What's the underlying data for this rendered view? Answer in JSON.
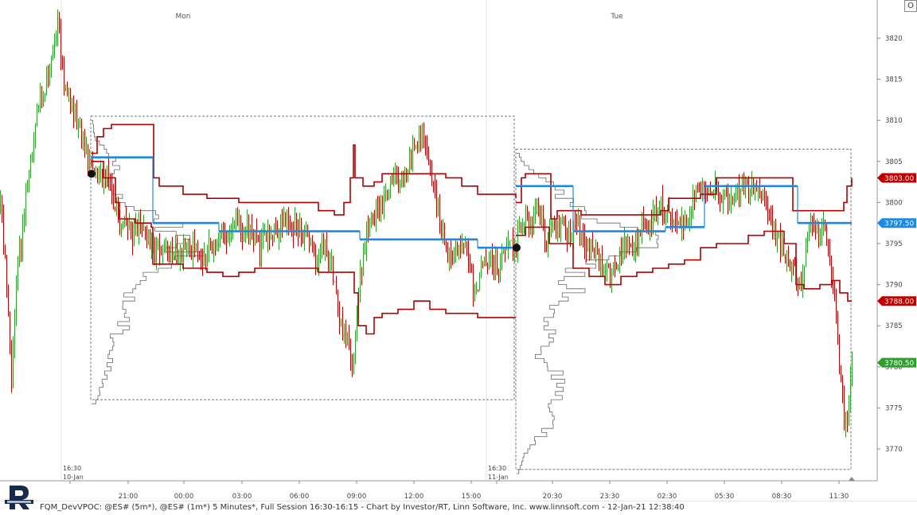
{
  "chart_data": {
    "type": "candlestick",
    "days": [
      "Mon",
      "Tue"
    ],
    "session_labels": [
      {
        "time": "16:30",
        "date": "10-Jan"
      },
      {
        "time": "16:30",
        "date": "11-Jan"
      }
    ],
    "x_ticks": [
      "16:30",
      "21:00",
      "00:00",
      "03:00",
      "06:00",
      "09:00",
      "12:00",
      "15:00",
      "16:30",
      "20:30",
      "23:30",
      "02:30",
      "05:30",
      "08:30",
      "11:30"
    ],
    "y_ticks": [
      3770,
      3775,
      3780,
      3785,
      3790,
      3795,
      3800,
      3805,
      3810,
      3815,
      3820
    ],
    "ylim": [
      3766.5,
      3825
    ],
    "price_labels": [
      {
        "value": "3803.00",
        "color": "#c00000"
      },
      {
        "value": "3797.50",
        "color": "#1e88e5"
      },
      {
        "value": "3788.00",
        "color": "#c00000"
      },
      {
        "value": "3780.50",
        "color": "#2e9e2e"
      }
    ],
    "session1_vpoc": [
      {
        "from": "16:30",
        "to": "21:00",
        "value": 3805.5
      },
      {
        "from": "21:00",
        "to": "03:00",
        "value": 3797.5
      },
      {
        "from": "03:00",
        "to": "09:00",
        "value": 3796.5
      },
      {
        "from": "09:00",
        "to": "15:00",
        "value": 3795.5
      },
      {
        "from": "15:00",
        "to": "16:15",
        "value": 3794.5
      }
    ],
    "session2_vpoc": [
      {
        "from": "16:30",
        "to": "20:30",
        "value": 3802.0
      },
      {
        "from": "20:30",
        "to": "02:30",
        "value": 3796.5
      },
      {
        "from": "02:30",
        "to": "05:30",
        "value": 3797.0
      },
      {
        "from": "05:30",
        "to": "11:30",
        "value": 3802.0
      },
      {
        "from": "11:30",
        "to": "12:38",
        "value": 3797.5
      }
    ],
    "session1_range": [
      3776.0,
      3810.5
    ],
    "session2_range": [
      3767.5,
      3806.5
    ],
    "last_price": 3780.5
  },
  "footer": {
    "text": "FQM_DevVPOC: @ES# (5m*), @ES# (1m*) 5 Minutes*, Full Session 16:30-16:15 - Chart by Investor/RT, Linn Software, Inc. www.linnsoft.com - 12-Jan-21 12:38:40"
  },
  "toolbar": {
    "o_button": "O"
  },
  "colors": {
    "up": "#2e9e2e",
    "down": "#c00000",
    "vpoc": "#1e88e5",
    "value_area": "#b00000",
    "profile": "#666666"
  }
}
